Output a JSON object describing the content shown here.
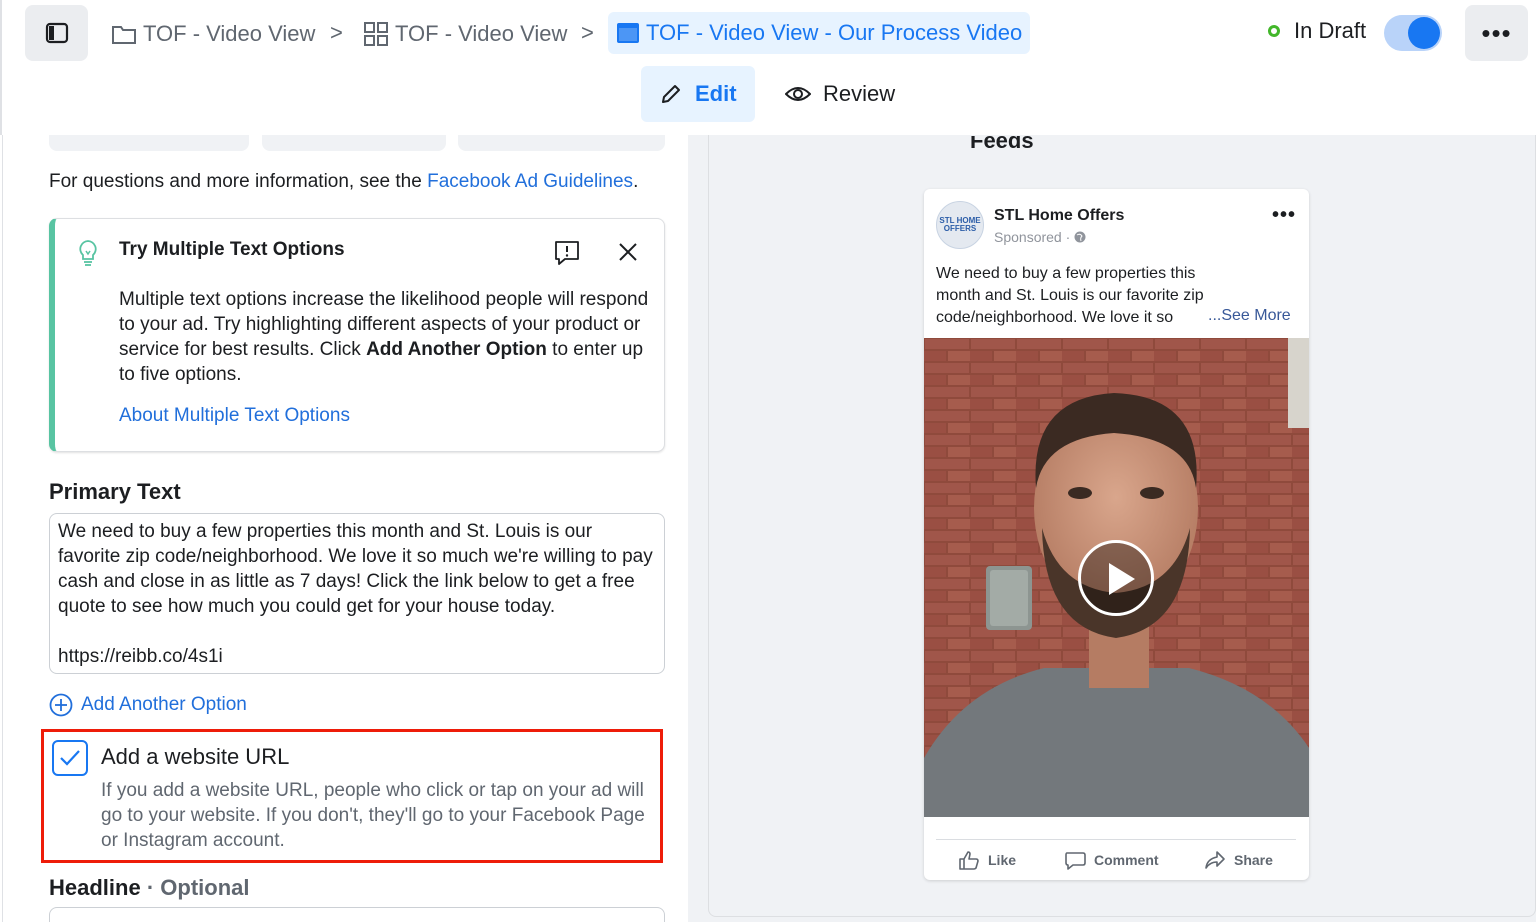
{
  "breadcrumb": {
    "items": [
      {
        "label": "TOF - Video View",
        "icon": "folder-icon"
      },
      {
        "label": "TOF - Video View",
        "icon": "grid-icon"
      },
      {
        "label": "TOF - Video View - Our Process Video",
        "icon": "ad-icon"
      }
    ],
    "separator": ">"
  },
  "status": {
    "label": "In Draft",
    "color": "#42b72a",
    "toggle_on": true
  },
  "more_label": "•••",
  "modes": {
    "edit_label": "Edit",
    "review_label": "Review"
  },
  "left": {
    "guidelines_prefix": "For questions and more information, see the ",
    "guidelines_link": "Facebook Ad Guidelines",
    "guidelines_suffix": ".",
    "tip": {
      "title": "Try Multiple Text Options",
      "body_part1": "Multiple text options increase the likelihood people will respond to your ad. Try highlighting different aspects of your product or service for best results. Click ",
      "body_bold": "Add Another Option",
      "body_part2": " to enter up to five options.",
      "link": "About Multiple Text Options",
      "accent_color": "#58c4a2"
    },
    "primary_text": {
      "title": "Primary Text",
      "value": "We need to buy a few properties this month and St. Louis is our favorite zip code/neighborhood. We love it so much we're willing to pay cash and close in as little as 7 days! Click the link below to get a free quote to see how much you could get for your house today.",
      "url": "https://reibb.co/4s1i"
    },
    "add_option_label": "Add Another Option",
    "website_url": {
      "checked": true,
      "title": "Add a website URL",
      "description": "If you add a website URL, people who click or tap on your ad will go to your website. If you don't, they'll go to your Facebook Page or Instagram account.",
      "highlight_color": "#ee1c09"
    },
    "headline": {
      "title": "Headline",
      "optional": "· Optional"
    }
  },
  "preview": {
    "placement_label": "Feeds",
    "page_name": "STL Home Offers",
    "avatar_text": "STL HOME OFFERS",
    "sponsored": "Sponsored · ",
    "text": "We need to buy a few properties this month and St. Louis is our favorite zip code/neighborhood. We love it so",
    "see_more": "...See More",
    "actions": {
      "like": "Like",
      "comment": "Comment",
      "share": "Share"
    }
  },
  "colors": {
    "accent": "#1877f2",
    "link": "#216fdb",
    "panel_bg": "#f0f2f5"
  }
}
